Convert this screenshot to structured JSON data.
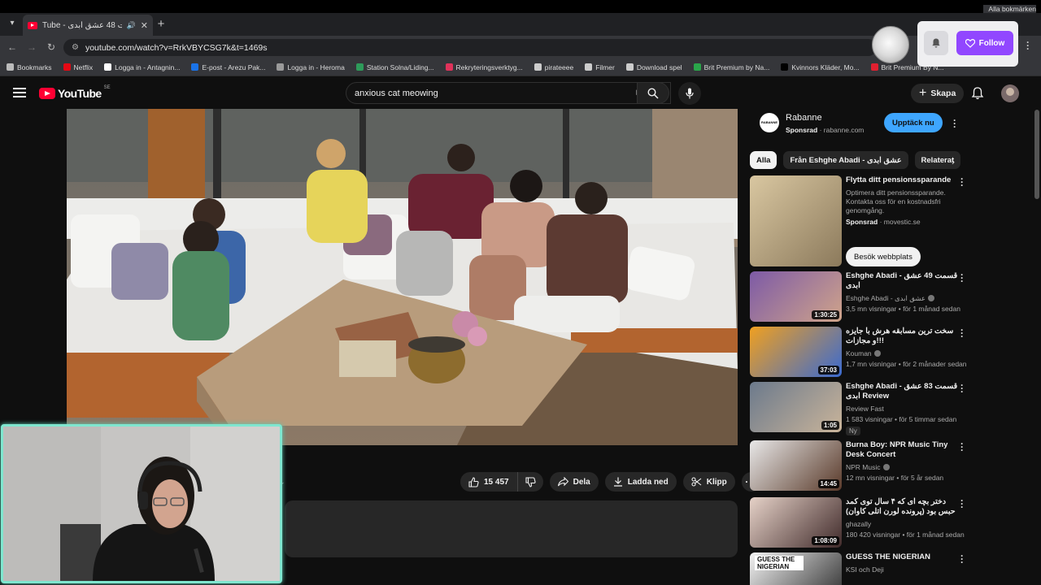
{
  "browser": {
    "tab": {
      "title": "Tube - قسمت 48 عشق ابدی"
    },
    "url": "youtube.com/watch?v=RrkVBYCSG7k&t=1469s",
    "bookmarks": [
      {
        "label": "Bookmarks",
        "color": "#bbbbbb"
      },
      {
        "label": "Netflix",
        "color": "#e50914"
      },
      {
        "label": "Logga in - Antagnin...",
        "color": "#ffffff"
      },
      {
        "label": "E-post - Arezu Pak...",
        "color": "#1a73e8"
      },
      {
        "label": "Logga in - Heroma",
        "color": "#9a9a9a"
      },
      {
        "label": "Station Solna/Liding...",
        "color": "#2e9b5a"
      },
      {
        "label": "Rekryteringsverktyg...",
        "color": "#e0325a"
      },
      {
        "label": "pirateeee",
        "color": "#cccccc"
      },
      {
        "label": "Filmer",
        "color": "#cccccc"
      },
      {
        "label": "Download spel",
        "color": "#cccccc"
      },
      {
        "label": "Brit Premium by Na...",
        "color": "#2aa64a"
      },
      {
        "label": "Kvinnors Kläder, Mo...",
        "color": "#000000"
      },
      {
        "label": "Brit Premium By N...",
        "color": "#e02030"
      }
    ],
    "bookmarks_overflow": "Alla bokmärken"
  },
  "youtube": {
    "logo_text": "YouTube",
    "country_code": "SE",
    "search_query": "anxious cat meowing",
    "create_label": "Skapa"
  },
  "extension": {
    "follow_label": "Follow"
  },
  "actions": {
    "likes": "15 457",
    "share": "Dela",
    "download": "Ladda ned",
    "clip": "Klipp"
  },
  "sidebar": {
    "ad": {
      "logo_text": "RABANNE",
      "name": "Rabanne",
      "sponsored": "Sponsrad",
      "domain": "rabanne.com",
      "cta": "Upptäck nu"
    },
    "chips": [
      "Alla",
      "Från Eshghe Abadi - عشق ابدی",
      "Relaterat"
    ],
    "items": [
      {
        "title": "Flytta ditt pensionssparande",
        "desc": "Optimera ditt pensionssparande. Kontakta oss för en kostnadsfri genomgång.",
        "sponsored": "Sponsrad",
        "domain": "movestic.se",
        "button": "Besök webbplats",
        "thumb": [
          "#d9c7a1",
          "#8c7a5c"
        ]
      },
      {
        "title": "Eshghe Abadi - قسمت 49 عشق ابدی",
        "channel": "Eshghe Abadi - عشق ابدی",
        "meta": "3,5 mn visningar • för 1 månad sedan",
        "duration": "1:30:25",
        "thumb": [
          "#7d5aa6",
          "#d0a48a"
        ]
      },
      {
        "title": "سخت ترین مسابقه هرش با جایزه و مجازات!!!",
        "channel": "Kouman",
        "meta": "1,7 mn visningar • för 2 månader sedan",
        "duration": "37:03",
        "thumb": [
          "#f0a020",
          "#3a6ad0"
        ]
      },
      {
        "title": "Eshghe Abadi - قسمت 83 عشق ابدی Review",
        "channel": "Review Fast",
        "meta": "1 583 visningar • för 5 timmar sedan",
        "badge": "Ny",
        "duration": "1:05",
        "thumb": [
          "#6c7a8c",
          "#c9b49a"
        ]
      },
      {
        "title": "Burna Boy: NPR Music Tiny Desk Concert",
        "channel": "NPR Music",
        "meta": "12 mn visningar • för 5 år sedan",
        "duration": "14:45",
        "thumb": [
          "#e8e8e8",
          "#5a3a2a"
        ]
      },
      {
        "title": "دختر بچه ای که ۴ سال توی کمد حبس بود (پرونده لورن اتلی کاوان)",
        "channel": "ghazally",
        "meta": "180 420 visningar • för 1 månad sedan",
        "duration": "1:08:09",
        "thumb": [
          "#e6d2c8",
          "#402a2a"
        ]
      },
      {
        "title": "GUESS THE NIGERIAN",
        "channel": "KSI och Deji",
        "thumb_text": "GUESS THE NIGERIAN",
        "thumb": [
          "#f4f4f4",
          "#2a2a2a"
        ]
      }
    ]
  }
}
